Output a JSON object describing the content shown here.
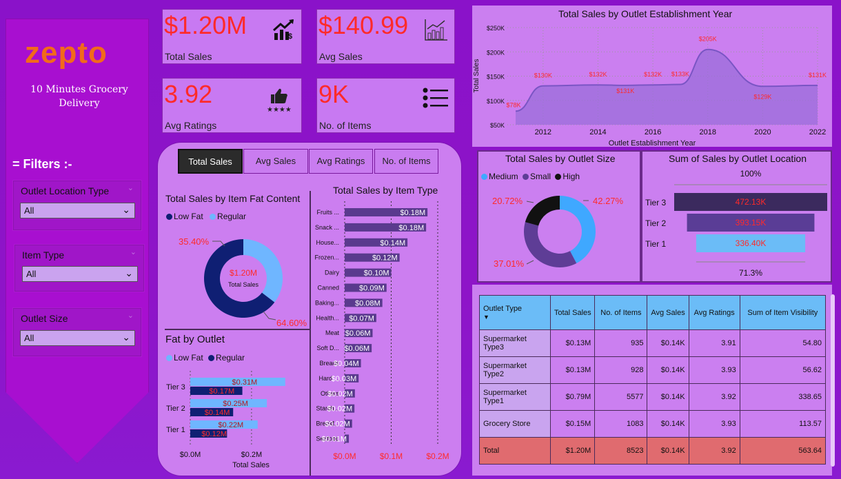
{
  "brand": {
    "name": "zepto",
    "tagline": "10 Minutes Grocery Delivery"
  },
  "filters": {
    "title": "= Filters :-",
    "items": [
      {
        "label": "Outlet Location Type",
        "value": "All"
      },
      {
        "label": "Item Type",
        "value": "All"
      },
      {
        "label": "Outlet Size",
        "value": "All"
      }
    ]
  },
  "kpis": [
    {
      "value": "$1.20M",
      "label": "Total Sales",
      "icon": "sales-growth-icon"
    },
    {
      "value": "$140.99",
      "label": "Avg Sales",
      "icon": "bar-growth-icon"
    },
    {
      "value": "3.92",
      "label": "Avg Ratings",
      "icon": "thumbs-up-stars-icon"
    },
    {
      "value": "9K",
      "label": "No. of Items",
      "icon": "list-icon"
    }
  ],
  "tabs": [
    "Total Sales",
    "Avg Sales",
    "Avg Ratings",
    "No. of Items"
  ],
  "fat_content": {
    "title": "Total Sales by Item Fat Content",
    "legend": [
      "Low Fat",
      "Regular"
    ],
    "center_value": "$1.20M",
    "center_label": "Total Sales",
    "labels": [
      "35.40%",
      "64.60%"
    ]
  },
  "fat_outlet": {
    "title": "Fat by Outlet",
    "legend": [
      "Low Fat",
      "Regular"
    ],
    "xlabel": "Total Sales",
    "ticks": [
      "$0.0M",
      "$0.2M"
    ]
  },
  "item_type": {
    "title": "Total Sales by Item Type",
    "ticks": [
      "$0.0M",
      "$0.1M",
      "$0.2M"
    ]
  },
  "year_chart": {
    "title": "Total Sales by Outlet Establishment Year",
    "xlabel": "Outlet Establishment Year",
    "ylabel": "Total Sales",
    "yticks": [
      "$250K",
      "$200K",
      "$150K",
      "$100K",
      "$50K"
    ],
    "xticks": [
      "2012",
      "2014",
      "2016",
      "2018",
      "2020",
      "2022"
    ]
  },
  "size_chart": {
    "title": "Total Sales by Outlet Size",
    "legend": [
      "Medium",
      "Small",
      "High"
    ],
    "labels": [
      "42.27%",
      "37.01%",
      "20.72%"
    ]
  },
  "location_chart": {
    "title": "Sum of Sales by Outlet Location",
    "top_label": "100%",
    "bottom_label": "71.3%"
  },
  "outlet_table": {
    "columns": [
      "Outlet Type",
      "Total Sales",
      "No. of Items",
      "Avg Sales",
      "Avg Ratings",
      "Sum of Item Visibility"
    ],
    "rows": [
      [
        "Supermarket Type3",
        "$0.13M",
        "935",
        "$0.14K",
        "3.91",
        "54.80"
      ],
      [
        "Supermarket Type2",
        "$0.13M",
        "928",
        "$0.14K",
        "3.93",
        "56.62"
      ],
      [
        "Supermarket Type1",
        "$0.79M",
        "5577",
        "$0.14K",
        "3.92",
        "338.65"
      ],
      [
        "Grocery Store",
        "$0.15M",
        "1083",
        "$0.14K",
        "3.93",
        "113.57"
      ]
    ],
    "total": [
      "Total",
      "$1.20M",
      "8523",
      "$0.14K",
      "3.92",
      "563.64"
    ]
  },
  "colors": {
    "accent_red": "#ff2a2a",
    "low_fat": "#0f1f73",
    "regular": "#6fb6ff",
    "bar_purple": "#5a3a8e",
    "medium": "#3fa8ff",
    "small": "#5e3d96",
    "high": "#111111",
    "header_blue": "#6bbcf7",
    "total_row": "#e06b6f"
  },
  "chart_data": [
    {
      "type": "pie",
      "title": "Total Sales by Item Fat Content",
      "categories": [
        "Regular",
        "Low Fat"
      ],
      "values": [
        35.4,
        64.6
      ]
    },
    {
      "type": "bar",
      "title": "Fat by Outlet",
      "categories": [
        "Tier 3",
        "Tier 2",
        "Tier 1"
      ],
      "series": [
        {
          "name": "Low Fat",
          "values": [
            0.31,
            0.25,
            0.22
          ],
          "labels": [
            "$0.31M",
            "$0.25M",
            "$0.22M"
          ]
        },
        {
          "name": "Regular",
          "values": [
            0.17,
            0.14,
            0.12
          ],
          "labels": [
            "$0.17M",
            "$0.14M",
            "$0.12M"
          ]
        }
      ],
      "xlabel": "Total Sales",
      "xlim": [
        0,
        0.35
      ]
    },
    {
      "type": "bar",
      "title": "Total Sales by Item Type",
      "categories": [
        "Fruits ...",
        "Snack ...",
        "House...",
        "Frozen...",
        "Dairy",
        "Canned",
        "Baking...",
        "Health...",
        "Meat",
        "Soft D...",
        "Breads",
        "Hard ...",
        "Others",
        "Starch...",
        "Breakf...",
        "Seafood"
      ],
      "values": [
        0.178,
        0.175,
        0.135,
        0.118,
        0.1,
        0.09,
        0.081,
        0.068,
        0.06,
        0.058,
        0.035,
        0.03,
        0.022,
        0.021,
        0.016,
        0.009
      ],
      "labels": [
        "$0.18M",
        "$0.18M",
        "$0.14M",
        "$0.12M",
        "$0.10M",
        "$0.09M",
        "$0.08M",
        "$0.07M",
        "$0.06M",
        "$0.06M",
        "$0.04M",
        "$0.03M",
        "$0.02M",
        "$0.02M",
        "$0.02M",
        "$0.01M"
      ],
      "xlim": [
        0,
        0.2
      ]
    },
    {
      "type": "area",
      "title": "Total Sales by Outlet Establishment Year",
      "x": [
        2011,
        2012,
        2014,
        2015,
        2016,
        2017,
        2018,
        2020,
        2022
      ],
      "y": [
        78,
        130,
        132,
        131,
        132,
        133,
        205,
        129,
        131
      ],
      "labels": [
        "$78K",
        "$130K",
        "$132K",
        "$131K",
        "$132K",
        "$133K",
        "$205K",
        "$129K",
        "$131K"
      ],
      "ylim": [
        50,
        250
      ],
      "xlabel": "Outlet Establishment Year",
      "ylabel": "Total Sales"
    },
    {
      "type": "pie",
      "title": "Total Sales by Outlet Size",
      "categories": [
        "Medium",
        "Small",
        "High"
      ],
      "values": [
        42.27,
        37.01,
        20.72
      ]
    },
    {
      "type": "bar",
      "title": "Sum of Sales by Outlet Location",
      "categories": [
        "Tier 3",
        "Tier 2",
        "Tier 1"
      ],
      "values": [
        472.13,
        393.15,
        336.4
      ],
      "labels": [
        "472.13K",
        "393.15K",
        "336.40K"
      ]
    }
  ]
}
